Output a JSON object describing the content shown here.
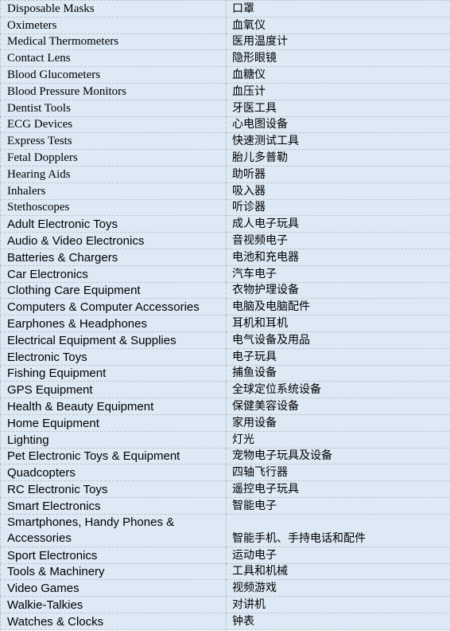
{
  "table": {
    "rows": [
      {
        "en": "Disposable Masks",
        "zh": "口罩",
        "font": "serif"
      },
      {
        "en": "Oximeters",
        "zh": "血氧仪",
        "font": "serif"
      },
      {
        "en": "Medical Thermometers",
        "zh": "医用温度计",
        "font": "serif"
      },
      {
        "en": "Contact Lens",
        "zh": "隐形眼镜",
        "font": "serif"
      },
      {
        "en": "Blood Glucometers",
        "zh": "血糖仪",
        "font": "serif"
      },
      {
        "en": "Blood Pressure Monitors",
        "zh": "血压计",
        "font": "serif"
      },
      {
        "en": "Dentist Tools",
        "zh": "牙医工具",
        "font": "serif"
      },
      {
        "en": "ECG Devices",
        "zh": "心电图设备",
        "font": "serif"
      },
      {
        "en": "Express Tests",
        "zh": "快速测试工具",
        "font": "serif"
      },
      {
        "en": "Fetal Dopplers",
        "zh": "胎儿多普勒",
        "font": "serif"
      },
      {
        "en": "Hearing Aids",
        "zh": "助听器",
        "font": "serif"
      },
      {
        "en": "Inhalers",
        "zh": "吸入器",
        "font": "serif"
      },
      {
        "en": "Stethoscopes",
        "zh": "听诊器",
        "font": "serif"
      },
      {
        "en": "Adult Electronic Toys",
        "zh": "成人电子玩具",
        "font": "sans"
      },
      {
        "en": "Audio & Video Electronics",
        "zh": "音视频电子",
        "font": "sans"
      },
      {
        "en": "Batteries & Chargers",
        "zh": "电池和充电器",
        "font": "sans"
      },
      {
        "en": "Car Electronics",
        "zh": "汽车电子",
        "font": "sans"
      },
      {
        "en": "Clothing Care Equipment",
        "zh": "衣物护理设备",
        "font": "sans"
      },
      {
        "en": "Computers & Computer Accessories",
        "zh": "电脑及电脑配件",
        "font": "sans"
      },
      {
        "en": "Earphones & Headphones",
        "zh": "耳机和耳机",
        "font": "sans"
      },
      {
        "en": "Electrical Equipment & Supplies",
        "zh": "电气设备及用品",
        "font": "sans"
      },
      {
        "en": "Electronic Toys",
        "zh": "电子玩具",
        "font": "sans"
      },
      {
        "en": "Fishing Equipment",
        "zh": "捕鱼设备",
        "font": "sans"
      },
      {
        "en": "GPS Equipment",
        "zh": "全球定位系统设备",
        "font": "sans"
      },
      {
        "en": "Health & Beauty Equipment",
        "zh": "保健美容设备",
        "font": "sans"
      },
      {
        "en": "Home Equipment",
        "zh": "家用设备",
        "font": "sans"
      },
      {
        "en": "Lighting",
        "zh": "灯光",
        "font": "sans"
      },
      {
        "en": "Pet Electronic Toys & Equipment",
        "zh": "宠物电子玩具及设备",
        "font": "sans"
      },
      {
        "en": "Quadcopters",
        "zh": "四轴飞行器",
        "font": "sans"
      },
      {
        "en": "RC Electronic Toys",
        "zh": "遥控电子玩具",
        "font": "sans"
      },
      {
        "en": "Smart Electronics",
        "zh": "智能电子",
        "font": "sans"
      },
      {
        "en": "Smartphones, Handy Phones & Accessories",
        "zh": "智能手机、手持电话和配件",
        "font": "sans",
        "wrap": true
      },
      {
        "en": "Sport Electronics",
        "zh": "运动电子",
        "font": "sans"
      },
      {
        "en": "Tools & Machinery",
        "zh": "工具和机械",
        "font": "sans"
      },
      {
        "en": "Video Games",
        "zh": "视频游戏",
        "font": "sans"
      },
      {
        "en": "Walkie-Talkies",
        "zh": "对讲机",
        "font": "sans"
      },
      {
        "en": "Watches & Clocks",
        "zh": "钟表",
        "font": "sans"
      }
    ]
  },
  "colors": {
    "cell_background": "#dde9f5",
    "border": "#c0c4c8",
    "text": "#000000"
  }
}
